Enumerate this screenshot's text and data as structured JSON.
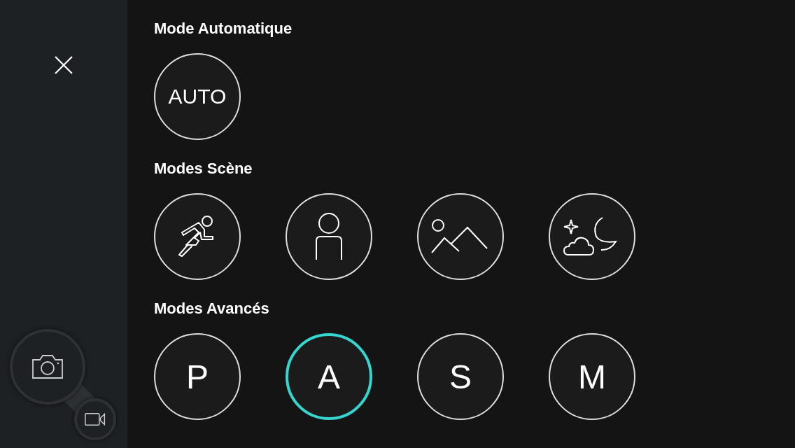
{
  "capture_modes": [
    {
      "kind": "photo",
      "selected": true
    },
    {
      "kind": "video",
      "selected": false
    }
  ],
  "sections": [
    {
      "title": "Mode Automatique",
      "modes": [
        {
          "kind": "text",
          "label": "AUTO",
          "selected": false
        }
      ]
    },
    {
      "title": "Modes Scène",
      "modes": [
        {
          "kind": "sport",
          "selected": false
        },
        {
          "kind": "portrait",
          "selected": false
        },
        {
          "kind": "landscape",
          "selected": false
        },
        {
          "kind": "night",
          "selected": false
        }
      ]
    },
    {
      "title": "Modes Avancés",
      "modes": [
        {
          "kind": "text",
          "label": "P",
          "selected": false
        },
        {
          "kind": "text",
          "label": "A",
          "selected": true
        },
        {
          "kind": "text",
          "label": "S",
          "selected": false
        },
        {
          "kind": "text",
          "label": "M",
          "selected": false
        }
      ]
    }
  ]
}
